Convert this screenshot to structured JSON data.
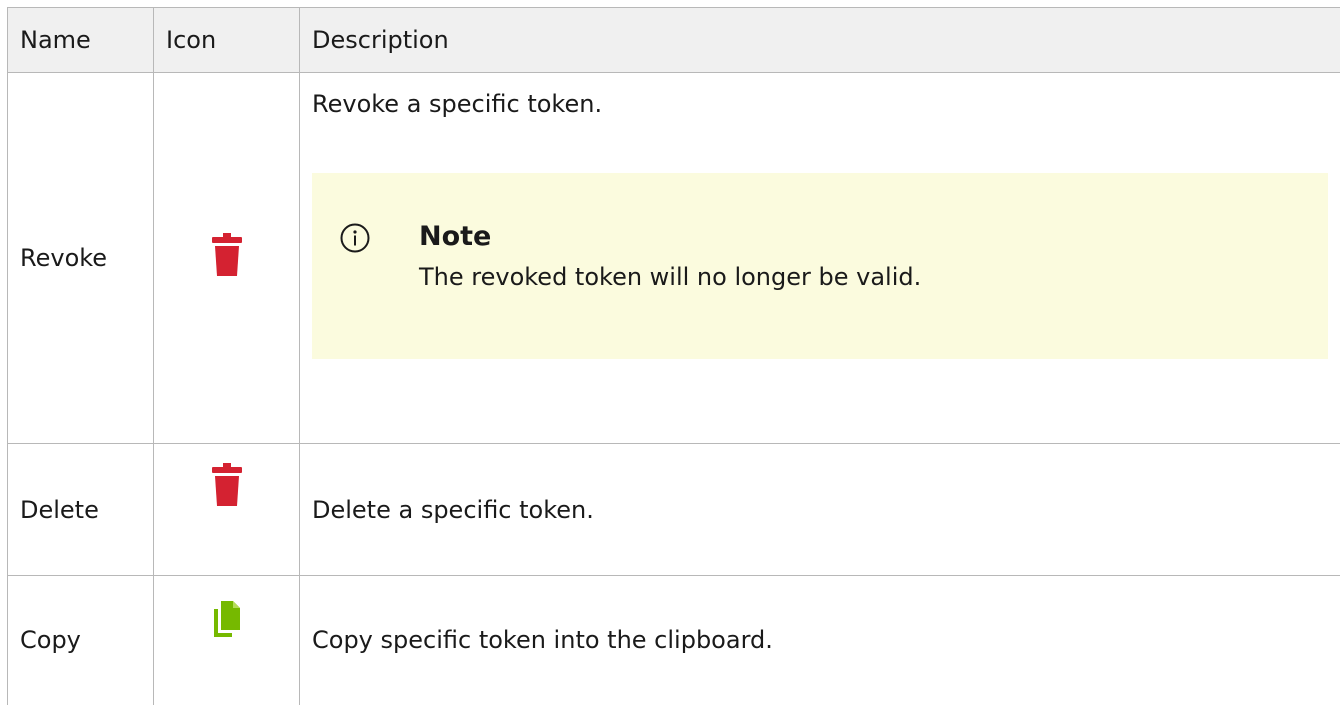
{
  "table": {
    "headers": [
      "Name",
      "Icon",
      "Description"
    ],
    "rows": [
      {
        "name": "Revoke",
        "icon": "trash-icon",
        "icon_color": "#d42231",
        "description": "Revoke a specific token.",
        "note": {
          "title": "Note",
          "body": "The revoked token will no longer be valid.",
          "icon": "info-icon"
        }
      },
      {
        "name": "Delete",
        "icon": "trash-icon",
        "icon_color": "#d42231",
        "description": "Delete a specific token."
      },
      {
        "name": "Copy",
        "icon": "copy-icon",
        "icon_color": "#76b900",
        "description": "Copy specific token into the clipboard."
      }
    ]
  },
  "colors": {
    "note_background": "#fbfbde",
    "header_background": "#f0f0f0",
    "border": "#b8b8b8"
  }
}
